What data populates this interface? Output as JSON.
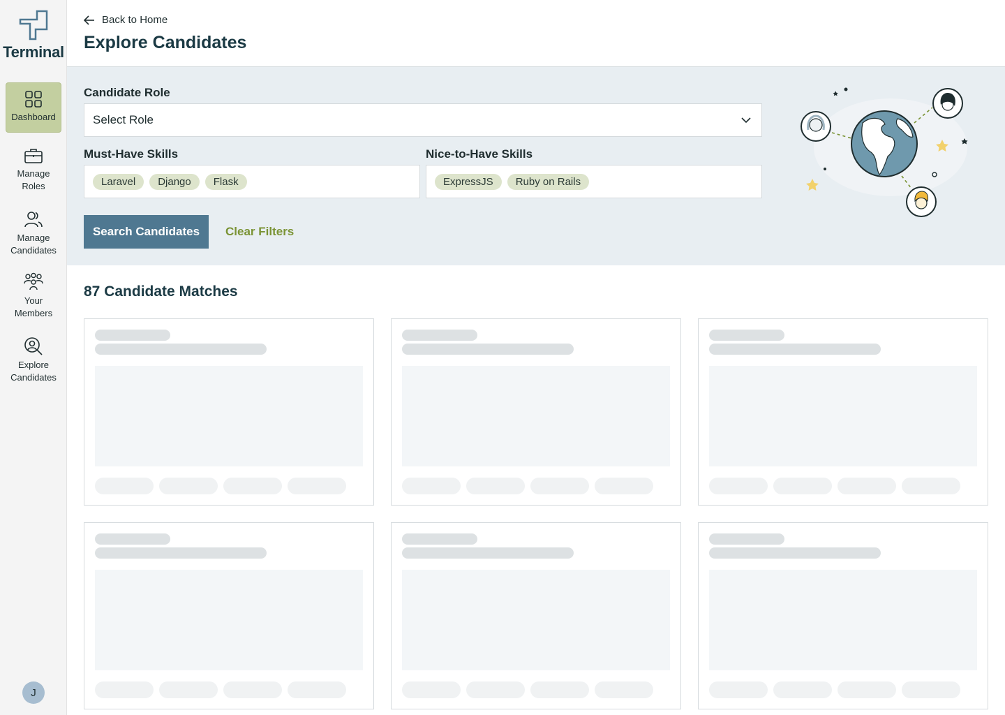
{
  "app": {
    "name": "Terminal"
  },
  "sidebar": {
    "items": [
      {
        "label_1": "Dashboard",
        "label_2": "",
        "icon": "grid-icon",
        "active": true
      },
      {
        "label_1": "Manage",
        "label_2": "Roles",
        "icon": "briefcase-icon",
        "active": false
      },
      {
        "label_1": "Manage",
        "label_2": "Candidates",
        "icon": "users-icon",
        "active": false
      },
      {
        "label_1": "Your",
        "label_2": "Members",
        "icon": "team-icon",
        "active": false
      },
      {
        "label_1": "Explore",
        "label_2": "Candidates",
        "icon": "search-person-icon",
        "active": false
      }
    ],
    "avatar_initial": "J"
  },
  "header": {
    "back_label": "Back to Home",
    "title": "Explore Candidates"
  },
  "filters": {
    "role_label": "Candidate Role",
    "role_value": "Select Role",
    "must_have_label": "Must-Have Skills",
    "must_have_tags": [
      "Laravel",
      "Django",
      "Flask"
    ],
    "nice_to_have_label": "Nice-to-Have Skills",
    "nice_to_have_tags": [
      "ExpressJS",
      "Ruby on Rails"
    ],
    "search_button": "Search Candidates",
    "clear_button": "Clear Filters"
  },
  "results": {
    "title": "87 Candidate Matches",
    "placeholder_cards": 6
  },
  "colors": {
    "accent_blue": "#4f7891",
    "accent_green": "#7a9334",
    "active_nav": "#c3cfa0",
    "panel_bg": "#e8eef2",
    "tag_bg": "#dde4cc"
  }
}
